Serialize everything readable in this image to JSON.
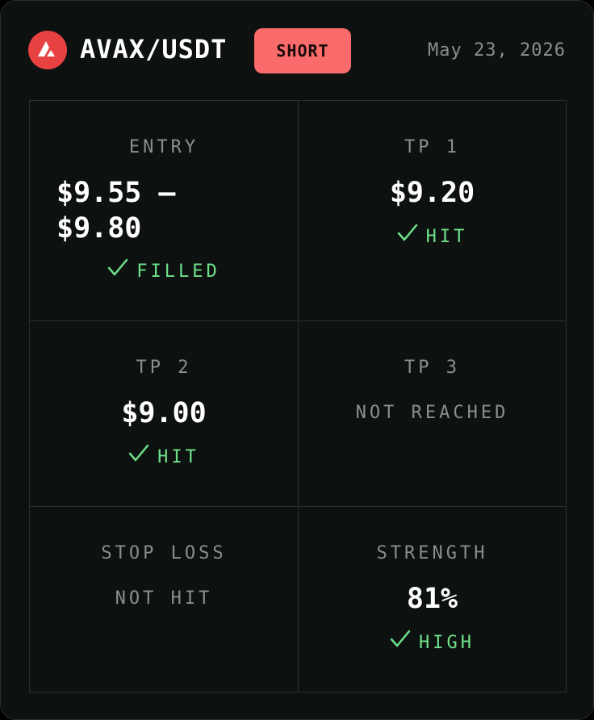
{
  "header": {
    "pair": "AVAX/USDT",
    "side": "SHORT",
    "date": "May 23, 2026",
    "logo_icon": "avalanche-logo-icon"
  },
  "colors": {
    "background": "#0d1210",
    "logo": "#e84142",
    "short_badge": "#fa6b6b",
    "success": "#6fe08a",
    "muted": "#8a8f8c"
  },
  "cells": {
    "entry": {
      "label": "ENTRY",
      "value": "$9.55 – $9.80",
      "status": "FILLED",
      "status_icon": "check-icon"
    },
    "tp1": {
      "label": "TP 1",
      "value": "$9.20",
      "status": "HIT",
      "status_icon": "check-icon"
    },
    "tp2": {
      "label": "TP 2",
      "value": "$9.00",
      "status": "HIT",
      "status_icon": "check-icon"
    },
    "tp3": {
      "label": "TP 3",
      "status": "NOT REACHED"
    },
    "stop_loss": {
      "label": "STOP LOSS",
      "status": "NOT HIT"
    },
    "strength": {
      "label": "STRENGTH",
      "value": "81%",
      "status": "HIGH",
      "status_icon": "check-icon"
    }
  }
}
